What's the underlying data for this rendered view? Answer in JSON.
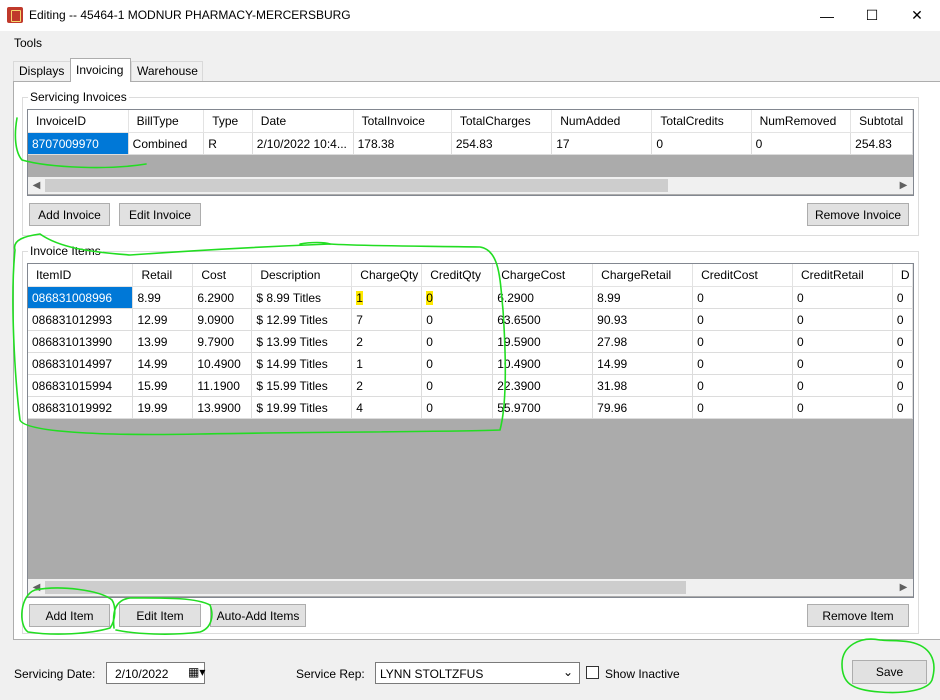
{
  "window": {
    "title": "Editing -- 45464-1 MODNUR PHARMACY-MERCERSBURG",
    "minimize": "—",
    "maximize": "☐",
    "close": "✕"
  },
  "menu": {
    "tools": "Tools"
  },
  "tabs": [
    {
      "label": "Displays"
    },
    {
      "label": "Invoicing"
    },
    {
      "label": "Warehouse"
    }
  ],
  "servicing_invoices": {
    "group_label": "Servicing Invoices",
    "columns": [
      "InvoiceID",
      "BillType",
      "Type",
      "Date",
      "TotalInvoice",
      "TotalCharges",
      "NumAdded",
      "TotalCredits",
      "NumRemoved",
      "Subtotal"
    ],
    "rows": [
      [
        "8707009970",
        "Combined",
        "R",
        "2/10/2022 10:4...",
        "178.38",
        "254.83",
        "17",
        "0",
        "0",
        "254.83"
      ]
    ],
    "buttons": {
      "add": "Add Invoice",
      "edit": "Edit Invoice",
      "remove": "Remove Invoice"
    }
  },
  "invoice_items": {
    "group_label": "Invoice Items",
    "columns": [
      "ItemID",
      "Retail",
      "Cost",
      "Description",
      "ChargeQty",
      "CreditQty",
      "ChargeCost",
      "ChargeRetail",
      "CreditCost",
      "CreditRetail",
      "D"
    ],
    "rows": [
      [
        "086831008996",
        "8.99",
        "6.2900",
        "$  8.99 Titles",
        "1",
        "0",
        "6.2900",
        "8.99",
        "0",
        "0",
        "0"
      ],
      [
        "086831012993",
        "12.99",
        "9.0900",
        "$ 12.99 Titles",
        "7",
        "0",
        "63.6500",
        "90.93",
        "0",
        "0",
        "0"
      ],
      [
        "086831013990",
        "13.99",
        "9.7900",
        "$ 13.99 Titles",
        "2",
        "0",
        "19.5900",
        "27.98",
        "0",
        "0",
        "0"
      ],
      [
        "086831014997",
        "14.99",
        "10.4900",
        "$ 14.99 Titles",
        "1",
        "0",
        "10.4900",
        "14.99",
        "0",
        "0",
        "0"
      ],
      [
        "086831015994",
        "15.99",
        "11.1900",
        "$ 15.99 Titles",
        "2",
        "0",
        "22.3900",
        "31.98",
        "0",
        "0",
        "0"
      ],
      [
        "086831019992",
        "19.99",
        "13.9900",
        "$ 19.99 Titles",
        "4",
        "0",
        "55.9700",
        "79.96",
        "0",
        "0",
        "0"
      ]
    ],
    "buttons": {
      "add": "Add Item",
      "edit": "Edit Item",
      "auto_add": "Auto-Add Items",
      "remove": "Remove Item"
    }
  },
  "footer": {
    "servicing_date_label": "Servicing Date:",
    "servicing_date_value": "2/10/2022",
    "service_rep_label": "Service Rep:",
    "service_rep_value": "LYNN STOLTZFUS",
    "show_inactive_label": "Show Inactive",
    "save_label": "Save"
  },
  "colors": {
    "selection": "#0078d7",
    "annotation": "#22dd22",
    "highlight": "#ffea00"
  }
}
